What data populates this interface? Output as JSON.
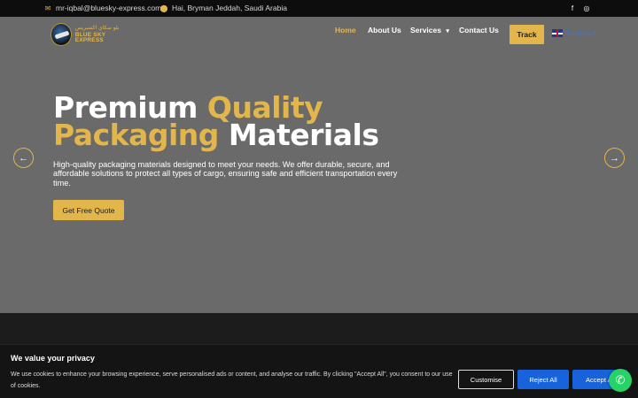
{
  "topbar": {
    "email": "mr-iqbal@bluesky-express.com",
    "email_icon": "envelope-icon",
    "address": "Hai, Bryman Jeddah, Saudi Arabia",
    "address_icon": "location-pin-icon",
    "social": [
      "facebook-icon",
      "instagram-icon"
    ]
  },
  "brand": {
    "logo_ar": "بلو سكاي اكسبريس",
    "logo_en": "BLUE SKY EXPRESS"
  },
  "nav": {
    "items": [
      {
        "label": "Home",
        "active": true
      },
      {
        "label": "About Us"
      },
      {
        "label": "Services",
        "has_dropdown": true
      },
      {
        "label": "Contact Us"
      }
    ],
    "track_label": "Track",
    "language": "English"
  },
  "hero": {
    "title_part1": "Premium ",
    "title_gold1": "Quality",
    "title_gold2": "Packaging",
    "title_part2": " Materials",
    "description": "High-quality packaging materials designed to meet your needs. We offer durable, secure, and affordable solutions to protect all types of cargo, ensuring safe and efficient transportation every time.",
    "cta_label": "Get Free Quote"
  },
  "cookie": {
    "title": "We value your privacy",
    "text": "We use cookies to enhance your browsing experience, serve personalised ads or content, and analyse our traffic. By clicking \"Accept All\", you consent to our use of cookies.",
    "customise_label": "Customise",
    "reject_label": "Reject All",
    "accept_label": "Accept All"
  },
  "colors": {
    "accent": "#e2b64a",
    "hero_bg": "#6a6a6a",
    "topbar_bg": "#0d0d0d",
    "cookie_button": "#1863dc",
    "whatsapp": "#25d366"
  }
}
